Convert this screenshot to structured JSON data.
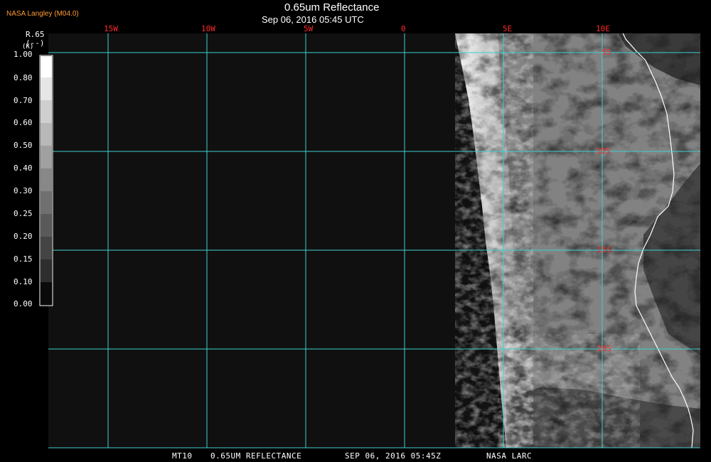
{
  "header": {
    "brand": "NASA Langley (M04.0)",
    "title": "0.65um Reflectance",
    "subtitle": "Sep 06, 2016 05:45 UTC"
  },
  "legend": {
    "variable": "R.65",
    "units_line": "(--)",
    "units_small": "(K)",
    "ticks": [
      "1.00",
      "0.80",
      "0.70",
      "0.60",
      "0.50",
      "0.40",
      "0.30",
      "0.25",
      "0.20",
      "0.15",
      "0.10",
      "0.00"
    ]
  },
  "grid": {
    "lon_labels": [
      "15W",
      "10W",
      "5W",
      "0",
      "5E",
      "10E"
    ],
    "lat_labels": [
      "5S",
      "10S",
      "15S",
      "20S"
    ],
    "line_color": "#3fd0d0",
    "label_color": "#ff2a2a"
  },
  "footer": {
    "product": "MT10",
    "name": "0.65UM REFLECTANCE",
    "datetime": "SEP 06, 2016 05:45Z",
    "source": "NASA LARC"
  }
}
